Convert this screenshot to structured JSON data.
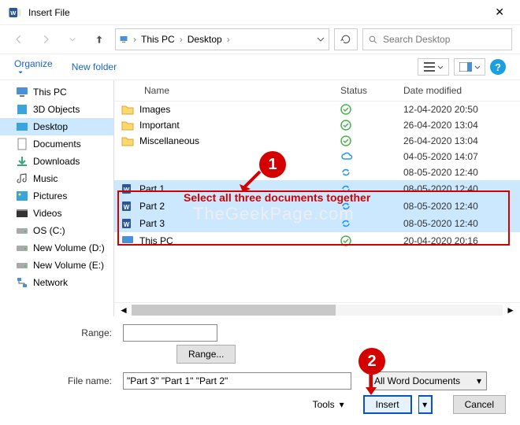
{
  "window": {
    "title": "Insert File"
  },
  "breadcrumb": {
    "thispc": "This PC",
    "desktop": "Desktop"
  },
  "search": {
    "placeholder": "Search Desktop"
  },
  "toolbar": {
    "organize": "Organize",
    "newfolder": "New folder"
  },
  "columns": {
    "name": "Name",
    "status": "Status",
    "date": "Date modified"
  },
  "sidebar": [
    {
      "label": "This PC",
      "icon": "pc"
    },
    {
      "label": "3D Objects",
      "icon": "3d"
    },
    {
      "label": "Desktop",
      "icon": "desk",
      "active": true
    },
    {
      "label": "Documents",
      "icon": "doc"
    },
    {
      "label": "Downloads",
      "icon": "down"
    },
    {
      "label": "Music",
      "icon": "music"
    },
    {
      "label": "Pictures",
      "icon": "pic"
    },
    {
      "label": "Videos",
      "icon": "vid"
    },
    {
      "label": "OS (C:)",
      "icon": "drive"
    },
    {
      "label": "New Volume (D:)",
      "icon": "drive"
    },
    {
      "label": "New Volume (E:)",
      "icon": "drive"
    },
    {
      "label": "Network",
      "icon": "net"
    }
  ],
  "files": [
    {
      "name": "Images",
      "icon": "folder",
      "status": "ok",
      "date": "12-04-2020 20:50"
    },
    {
      "name": "Important",
      "icon": "folder",
      "status": "ok",
      "date": "26-04-2020 13:04"
    },
    {
      "name": "Miscellaneous",
      "icon": "folder",
      "status": "ok",
      "date": "26-04-2020 13:04"
    },
    {
      "name": "",
      "icon": "",
      "status": "cloud",
      "date": "04-05-2020 14:07"
    },
    {
      "name": "",
      "icon": "",
      "status": "sync",
      "date": "08-05-2020 12:40"
    },
    {
      "name": "Part 1",
      "icon": "word",
      "status": "sync",
      "date": "08-05-2020 12:40",
      "sel": true
    },
    {
      "name": "Part 2",
      "icon": "word",
      "status": "sync",
      "date": "08-05-2020 12:40",
      "sel": true
    },
    {
      "name": "Part 3",
      "icon": "word",
      "status": "sync",
      "date": "08-05-2020 12:40",
      "sel": true
    },
    {
      "name": "This PC",
      "icon": "pc",
      "status": "ok",
      "date": "20-04-2020 20:16"
    }
  ],
  "annot": {
    "sel_text": "Select all three documents together",
    "n1": "1",
    "n2": "2",
    "watermark": "TheGeekPage.com"
  },
  "form": {
    "range_label": "Range:",
    "range_btn": "Range...",
    "filename_label": "File name:",
    "filename_value": "\"Part 3\" \"Part 1\" \"Part 2\"",
    "filter": "All Word Documents",
    "tools": "Tools",
    "insert": "Insert",
    "cancel": "Cancel"
  }
}
